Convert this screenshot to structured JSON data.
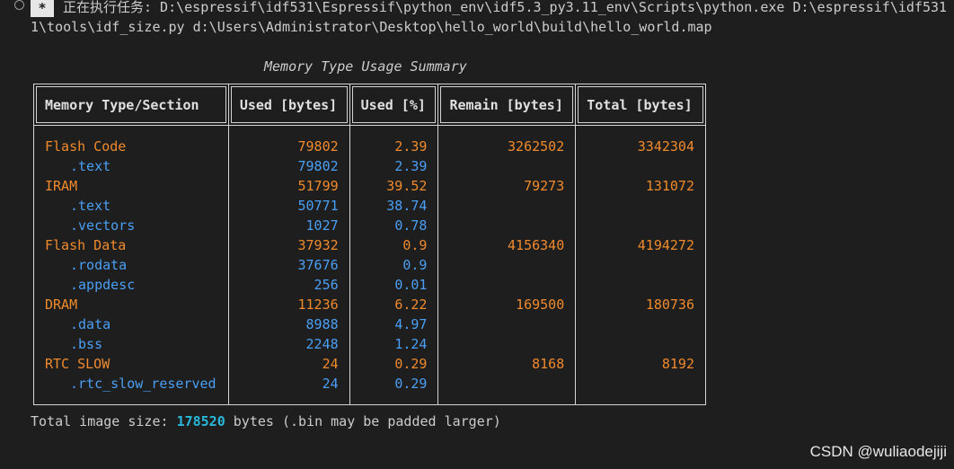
{
  "header": {
    "badge": "*",
    "line1": "正在执行任务: D:\\espressif\\idf531\\Espressif\\python_env\\idf5.3_py3.11_env\\Scripts\\python.exe D:\\espressif\\idf531",
    "line2": "1\\tools\\idf_size.py d:\\Users\\Administrator\\Desktop\\hello_world\\build\\hello_world.map"
  },
  "table": {
    "title": "Memory Type Usage Summary",
    "columns": [
      "Memory Type/Section",
      "Used [bytes]",
      "Used [%]",
      "Remain [bytes]",
      "Total [bytes]"
    ],
    "rows": [
      {
        "kind": "type",
        "name": "Flash Code",
        "used": "79802",
        "pct": "2.39",
        "remain": "3262502",
        "total": "3342304"
      },
      {
        "kind": "section",
        "name": ".text",
        "used": "79802",
        "pct": "2.39",
        "remain": "",
        "total": ""
      },
      {
        "kind": "type",
        "name": "IRAM",
        "used": "51799",
        "pct": "39.52",
        "remain": "79273",
        "total": "131072"
      },
      {
        "kind": "section",
        "name": ".text",
        "used": "50771",
        "pct": "38.74",
        "remain": "",
        "total": ""
      },
      {
        "kind": "section",
        "name": ".vectors",
        "used": "1027",
        "pct": "0.78",
        "remain": "",
        "total": ""
      },
      {
        "kind": "type",
        "name": "Flash Data",
        "used": "37932",
        "pct": "0.9",
        "remain": "4156340",
        "total": "4194272"
      },
      {
        "kind": "section",
        "name": ".rodata",
        "used": "37676",
        "pct": "0.9",
        "remain": "",
        "total": ""
      },
      {
        "kind": "section",
        "name": ".appdesc",
        "used": "256",
        "pct": "0.01",
        "remain": "",
        "total": ""
      },
      {
        "kind": "type",
        "name": "DRAM",
        "used": "11236",
        "pct": "6.22",
        "remain": "169500",
        "total": "180736"
      },
      {
        "kind": "section",
        "name": ".data",
        "used": "8988",
        "pct": "4.97",
        "remain": "",
        "total": ""
      },
      {
        "kind": "section",
        "name": ".bss",
        "used": "2248",
        "pct": "1.24",
        "remain": "",
        "total": ""
      },
      {
        "kind": "type",
        "name": "RTC SLOW",
        "used": "24",
        "pct": "0.29",
        "remain": "8168",
        "total": "8192"
      },
      {
        "kind": "section",
        "name": ".rtc_slow_reserved",
        "used": "24",
        "pct": "0.29",
        "remain": "",
        "total": ""
      }
    ]
  },
  "footer": {
    "prefix": "Total image size: ",
    "total": "178520",
    "suffix": " bytes (.bin may be padded larger)"
  },
  "watermark": "CSDN @wuliaodejiji",
  "colors": {
    "background": "#1e1e1e",
    "type_row": "#f08a2c",
    "section_row": "#4a9ff5",
    "total_highlight": "#29b8db"
  }
}
